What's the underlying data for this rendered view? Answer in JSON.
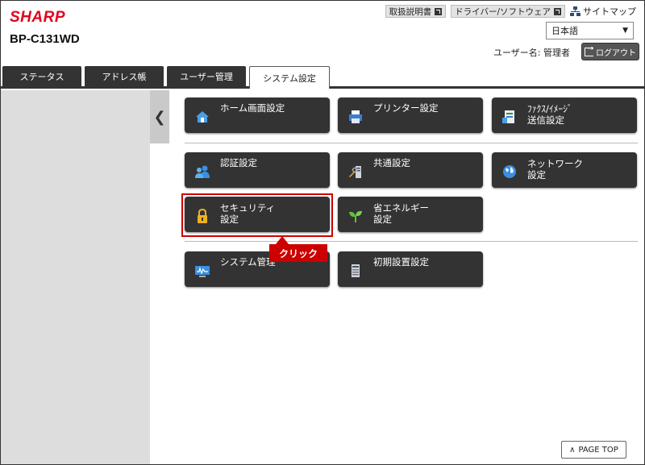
{
  "header": {
    "logo": "SHARP",
    "model": "BP-C131WD",
    "links": [
      {
        "label": "取扱説明書"
      },
      {
        "label": "ドライバー/ソフトウェア"
      }
    ],
    "sitemap": "サイトマップ",
    "language": "日本語",
    "user_label": "ユーザー名: 管理者",
    "logout": "ログアウト"
  },
  "tabs": [
    {
      "label": "ステータス",
      "active": false
    },
    {
      "label": "アドレス帳",
      "active": false
    },
    {
      "label": "ユーザー管理",
      "active": false
    },
    {
      "label": "システム設定",
      "active": true
    }
  ],
  "tiles": [
    {
      "label": "ホーム画面設定",
      "icon": "home-icon"
    },
    {
      "label": "プリンター設定",
      "icon": "printer-icon"
    },
    {
      "label": "ﾌｧｸｽ/ｲﾒｰｼﾞ\n送信設定",
      "icon": "fax-icon"
    },
    {
      "label": "認証設定",
      "icon": "users-icon"
    },
    {
      "label": "共通設定",
      "icon": "tools-icon"
    },
    {
      "label": "ネットワーク\n設定",
      "icon": "globe-icon"
    },
    {
      "label": "セキュリティ\n設定",
      "icon": "lock-icon"
    },
    {
      "label": "省エネルギー\n設定",
      "icon": "leaf-icon"
    },
    {
      "label": "システム管理",
      "icon": "monitor-icon"
    },
    {
      "label": "初期設置設定",
      "icon": "device-icon"
    }
  ],
  "callout": "クリック",
  "page_top": "PAGE TOP",
  "colors": {
    "brand": "#e6001e",
    "tile": "#333333",
    "highlight": "#cc0000"
  }
}
